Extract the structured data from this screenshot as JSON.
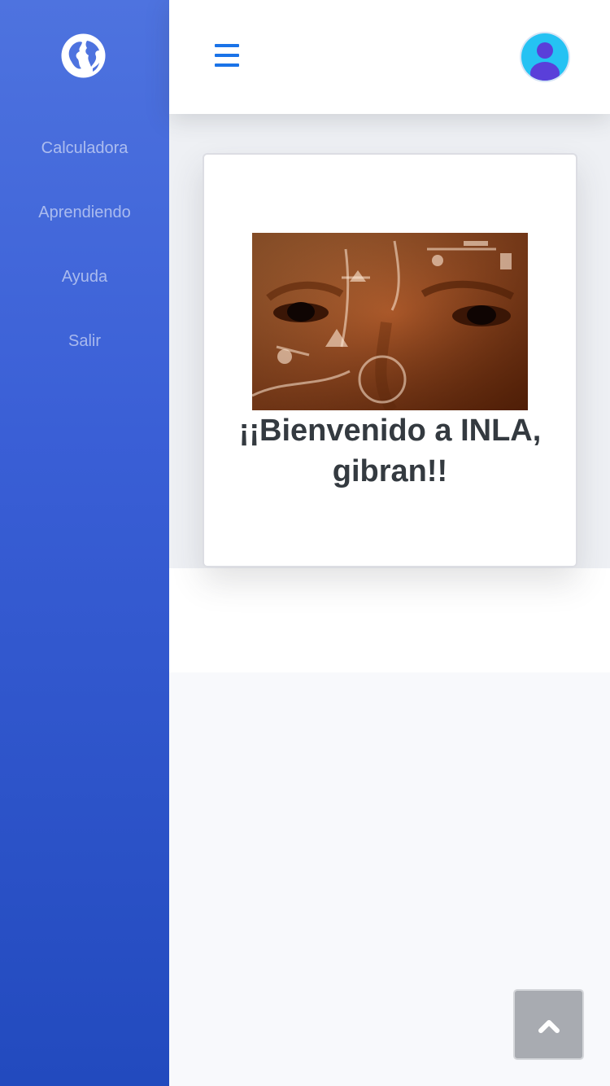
{
  "sidebar": {
    "brand_icon": "globe-icon",
    "items": [
      {
        "label": "Calculadora"
      },
      {
        "label": "Aprendiendo"
      },
      {
        "label": "Ayuda"
      },
      {
        "label": "Salir"
      }
    ]
  },
  "topbar": {
    "menu_icon": "hamburger-menu-icon",
    "avatar_icon": "user-avatar-icon"
  },
  "main": {
    "welcome_text": "¡¡Bienvenido a INLA, gibran!!"
  },
  "scroll_top_icon": "chevron-up-icon",
  "colors": {
    "sidebar_top": "#4e73df",
    "sidebar_bottom": "#224abe",
    "accent": "#1a73e8",
    "heading_text": "#343a40"
  }
}
